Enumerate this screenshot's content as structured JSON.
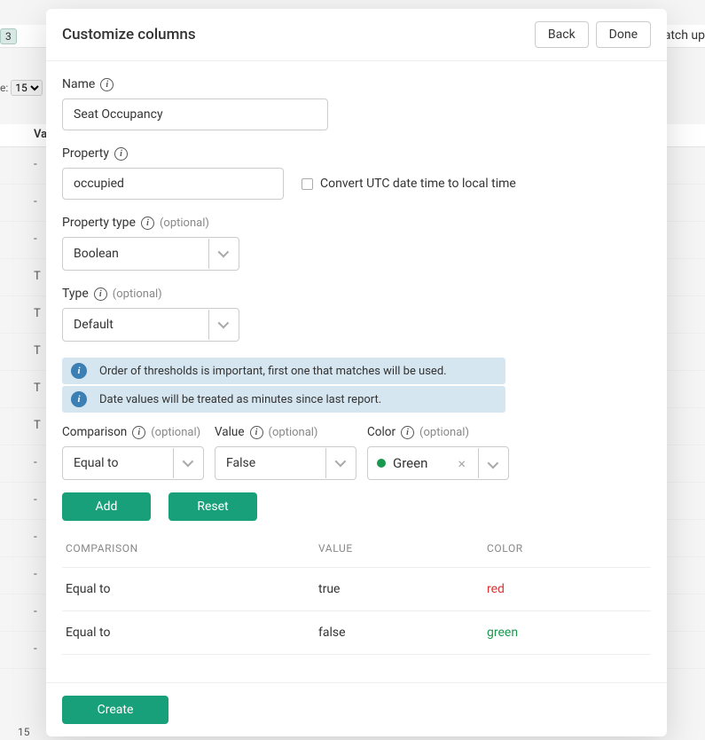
{
  "bg": {
    "badge": "3",
    "catchup": "atch up",
    "pagesize_label": "e:",
    "pagesize_value": "15",
    "va": "Va",
    "rows": [
      "-",
      "-",
      "-",
      "T",
      "T",
      "T",
      "T",
      "T",
      "-",
      "-",
      "-",
      "-",
      "-",
      "-"
    ],
    "bottom": "15"
  },
  "modal": {
    "title": "Customize columns",
    "back": "Back",
    "done": "Done",
    "name_label": "Name",
    "name_value": "Seat Occupancy",
    "property_label": "Property",
    "property_value": "occupied",
    "convert_utc": "Convert UTC date time to local time",
    "ptype_label": "Property type",
    "ptype_value": "Boolean",
    "type_label": "Type",
    "type_value": "Default",
    "optional": "(optional)",
    "alert1": "Order of thresholds is important, first one that matches will be used.",
    "alert2": "Date values will be treated as minutes since last report.",
    "comp_label": "Comparison",
    "comp_value": "Equal to",
    "val_label": "Value",
    "val_value": "False",
    "color_label": "Color",
    "color_value": "Green",
    "color_swatch": "#1a9850",
    "add": "Add",
    "reset": "Reset",
    "thead": {
      "c1": "COMPARISON",
      "c2": "VALUE",
      "c3": "COLOR"
    },
    "rows": [
      {
        "comp": "Equal to",
        "val": "true",
        "color": "red",
        "clr_class": "clr-red"
      },
      {
        "comp": "Equal to",
        "val": "false",
        "color": "green",
        "clr_class": "clr-green"
      }
    ],
    "create": "Create"
  }
}
